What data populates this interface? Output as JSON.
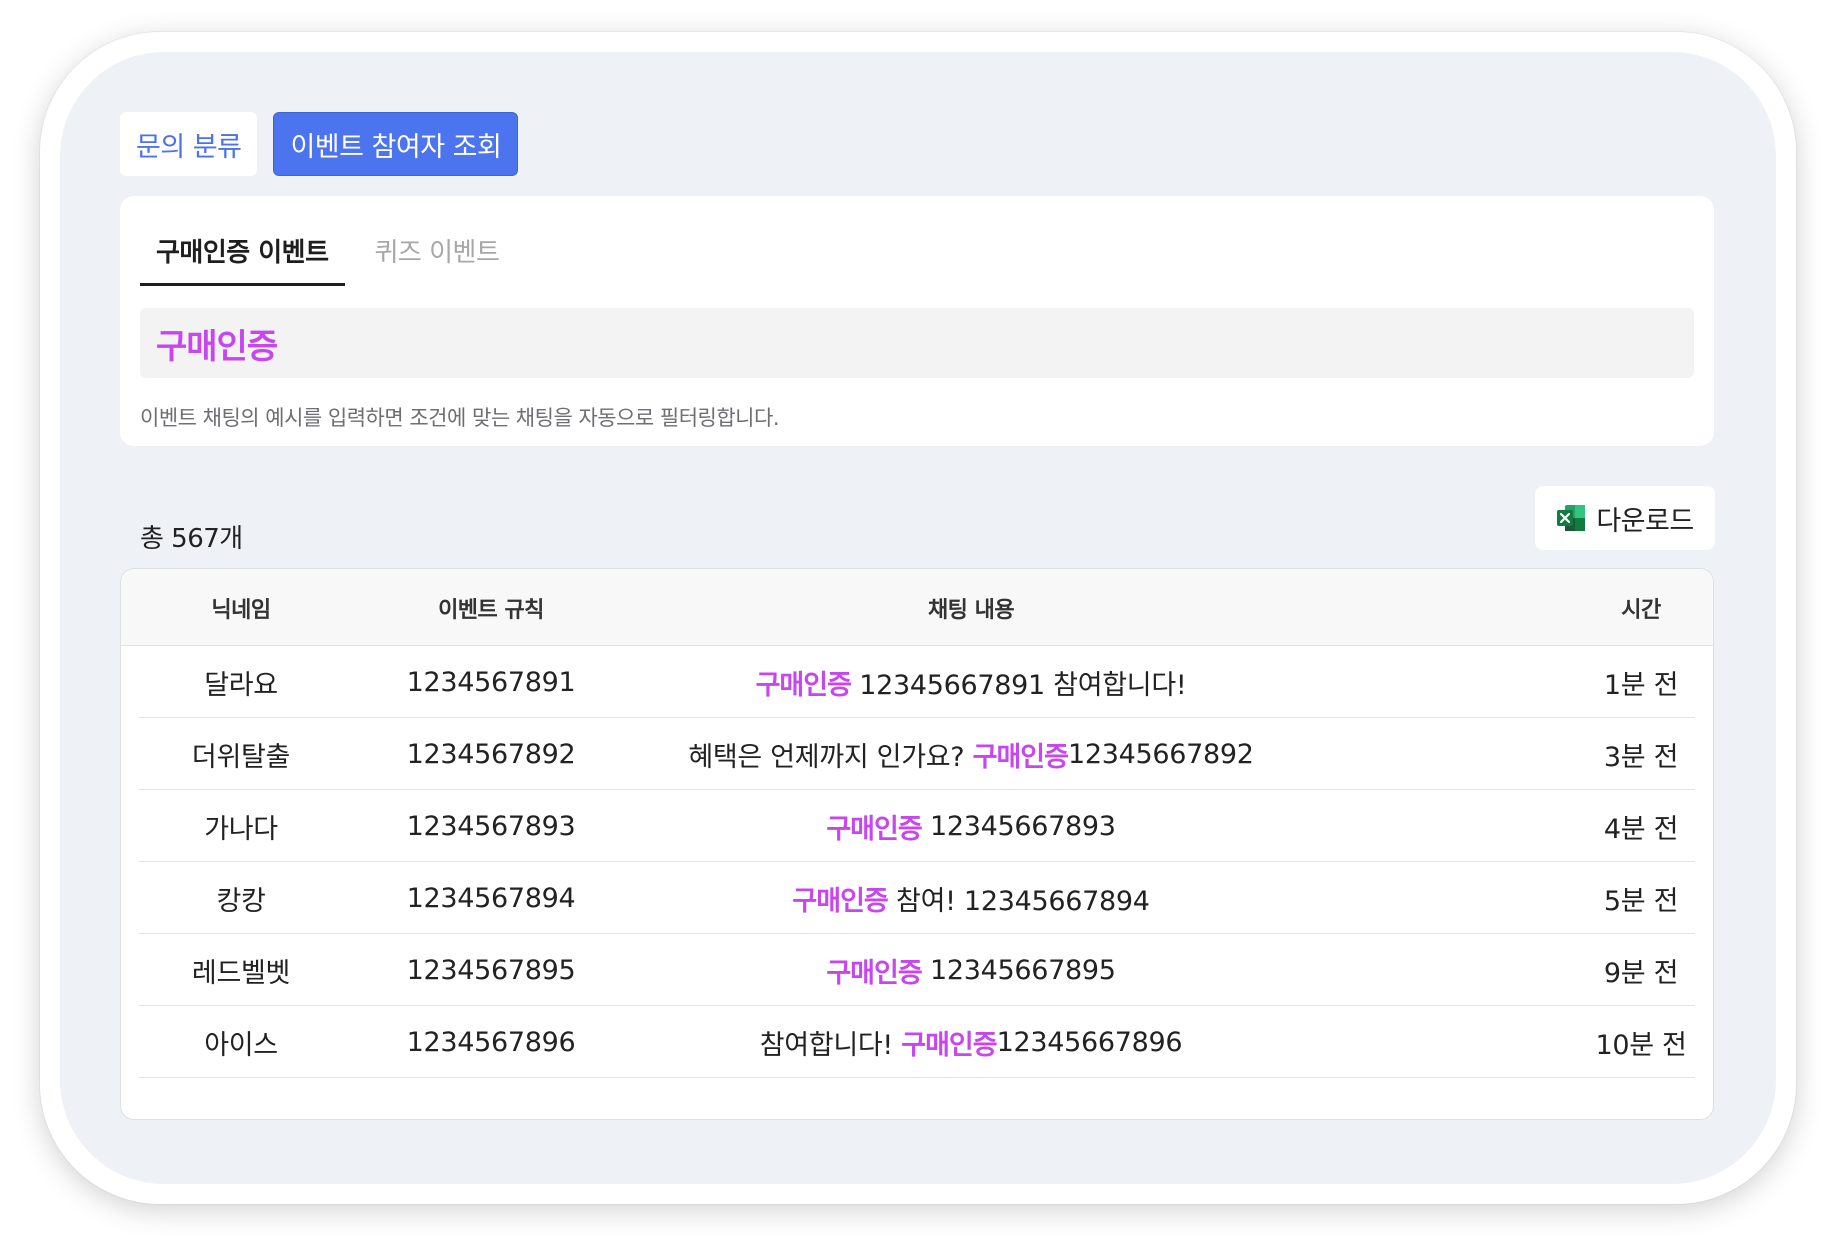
{
  "top_tabs": [
    {
      "label": "문의 분류",
      "active": false
    },
    {
      "label": "이벤트 참여자 조회",
      "active": true
    }
  ],
  "sub_tabs": [
    {
      "label": "구매인증 이벤트",
      "active": true
    },
    {
      "label": "퀴즈 이벤트",
      "active": false
    }
  ],
  "keyword": "구매인증",
  "hint": "이벤트 채팅의 예시를 입력하면 조건에 맞는 채팅을 자동으로 필터링합니다.",
  "total_label": "총 567개",
  "download": {
    "label": "다운로드",
    "icon": "excel-icon"
  },
  "table": {
    "headers": {
      "nickname": "닉네임",
      "rule": "이벤트 규칙",
      "chat": "채팅 내용",
      "time": "시간"
    },
    "rows": [
      {
        "nickname": "달라요",
        "rule": "1234567891",
        "chat_pre": "",
        "chat_kw": "구매인증",
        "chat_post": " 12345667891 참여합니다!",
        "time": "1분 전"
      },
      {
        "nickname": "더위탈출",
        "rule": "1234567892",
        "chat_pre": "혜택은 언제까지 인가요? ",
        "chat_kw": "구매인증",
        "chat_post": "12345667892",
        "time": "3분 전"
      },
      {
        "nickname": "가나다",
        "rule": "1234567893",
        "chat_pre": "",
        "chat_kw": "구매인증",
        "chat_post": " 12345667893",
        "time": "4분 전"
      },
      {
        "nickname": "캉캉",
        "rule": "1234567894",
        "chat_pre": "",
        "chat_kw": "구매인증",
        "chat_post": " 참여! 12345667894",
        "time": "5분 전"
      },
      {
        "nickname": "레드벨벳",
        "rule": "1234567895",
        "chat_pre": "",
        "chat_kw": "구매인증",
        "chat_post": " 12345667895",
        "time": "9분 전"
      },
      {
        "nickname": "아이스",
        "rule": "1234567896",
        "chat_pre": "참여합니다! ",
        "chat_kw": "구매인증",
        "chat_post": "12345667896",
        "time": "10분 전"
      }
    ]
  },
  "colors": {
    "primary": "#4c74ee",
    "keyword": "#c746ee",
    "background": "#eef1f6"
  }
}
